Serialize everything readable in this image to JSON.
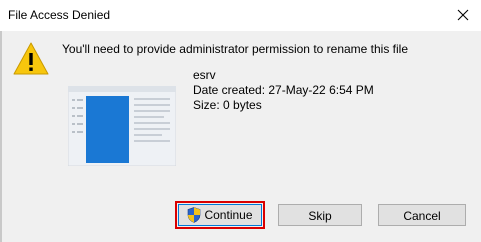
{
  "window": {
    "title": "File Access Denied",
    "close_icon": "close-icon"
  },
  "dialog": {
    "icon": "warning-icon",
    "message": "You'll need to provide administrator permission to rename this file",
    "file": {
      "name": "esrv",
      "date_created": "Date created: 27-May-22 6:54 PM",
      "size": "Size: 0 bytes",
      "thumbnail_icon": "generic-file-thumbnail"
    }
  },
  "buttons": {
    "continue_label": "Continue",
    "continue_icon": "uac-shield-icon",
    "skip_label": "Skip",
    "cancel_label": "Cancel"
  },
  "colors": {
    "dialog_background": "#f0f0f0",
    "titlebar_background": "#ffffff",
    "button_background": "#e1e1e1",
    "focus_border": "#0078d7",
    "highlight_border": "#d90000",
    "warning_yellow": "#f7c60d"
  }
}
